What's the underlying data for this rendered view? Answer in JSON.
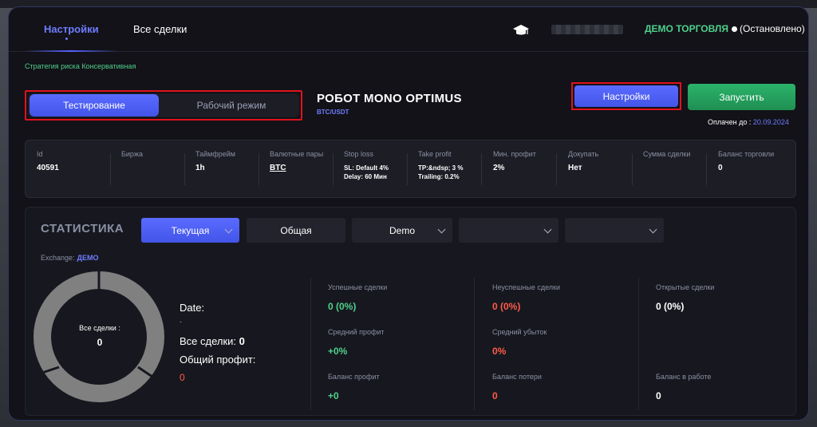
{
  "header": {
    "tabs": [
      {
        "label": "Настройки",
        "active": true
      },
      {
        "label": "Все сделки",
        "active": false
      }
    ],
    "account_status": {
      "label": "ДЕМО ТОРГОВЛЯ",
      "state": "(Остановлено)"
    },
    "icons": [
      "graduation-cap-icon"
    ]
  },
  "strategy_text": "Стратегия риска Консервативная",
  "mode_switch": {
    "testing": "Тестирование",
    "live": "Рабочий режим",
    "selected": "testing"
  },
  "robot": {
    "title": "РОБОТ MONO OPTIMUS",
    "pair": "BTC/USDT"
  },
  "actions": {
    "settings": "Настройки",
    "run": "Запустить",
    "paid_label": "Оплачен до :",
    "paid_date": "20.09.2024"
  },
  "info": {
    "id": {
      "label": "Id",
      "value": "40591"
    },
    "exchange": {
      "label": "Биржа",
      "value": ""
    },
    "timeframe": {
      "label": "Таймфрейм",
      "value": "1h"
    },
    "pairs": {
      "label": "Валютные пары",
      "value": "BTC"
    },
    "stop_loss": {
      "label": "Stop loss",
      "line1": "SL:  Default 4%",
      "line2": "Delay:  60 Мин"
    },
    "take_profit": {
      "label": "Take profit",
      "line1": "TP:&ndsp; 3 %",
      "line2": "Trailing: 0.2%"
    },
    "min_profit": {
      "label": "Мин. профит",
      "value": "2%"
    },
    "dokupat": {
      "label": "Докупать",
      "value": "Нет"
    },
    "deal_sum": {
      "label": "Сумма сделки",
      "value": ""
    },
    "balance": {
      "label": "Баланс торговли",
      "value": "0"
    }
  },
  "stats": {
    "title": "СТАТИСТИКА",
    "filters": {
      "current": "Текущая",
      "general": "Общая",
      "demo": "Demo"
    },
    "exchange_label": "Exchange:",
    "exchange_value": "ДЕМО",
    "donut_label": "Все сделки :",
    "donut_value": "0",
    "date_label": "Date:",
    "date_value": "-",
    "all_deals_label": "Все сделки:",
    "all_deals_value": "0",
    "total_profit_label": "Общий профит:",
    "total_profit_value": "0",
    "metrics": {
      "success_label": "Успешные сделки",
      "success_value": "0 (0%)",
      "fail_label": "Неуспешные сделки",
      "fail_value": "0 (0%)",
      "open_label": "Открытые сделки",
      "open_value": "0 (0%)",
      "avg_profit_label": "Средний профит",
      "avg_profit_value": "+0%",
      "avg_loss_label": "Средний убыток",
      "avg_loss_value": "0%",
      "bal_profit_label": "Баланс профит",
      "bal_profit_value": "+0",
      "bal_loss_label": "Баланс потери",
      "bal_loss_value": "0",
      "bal_work_label": "Баланс в работе",
      "bal_work_value": "0"
    }
  },
  "colors": {
    "accent": "#5564ff",
    "green": "#4fd08b",
    "red": "#ff5a4a",
    "run": "#24a45e"
  }
}
